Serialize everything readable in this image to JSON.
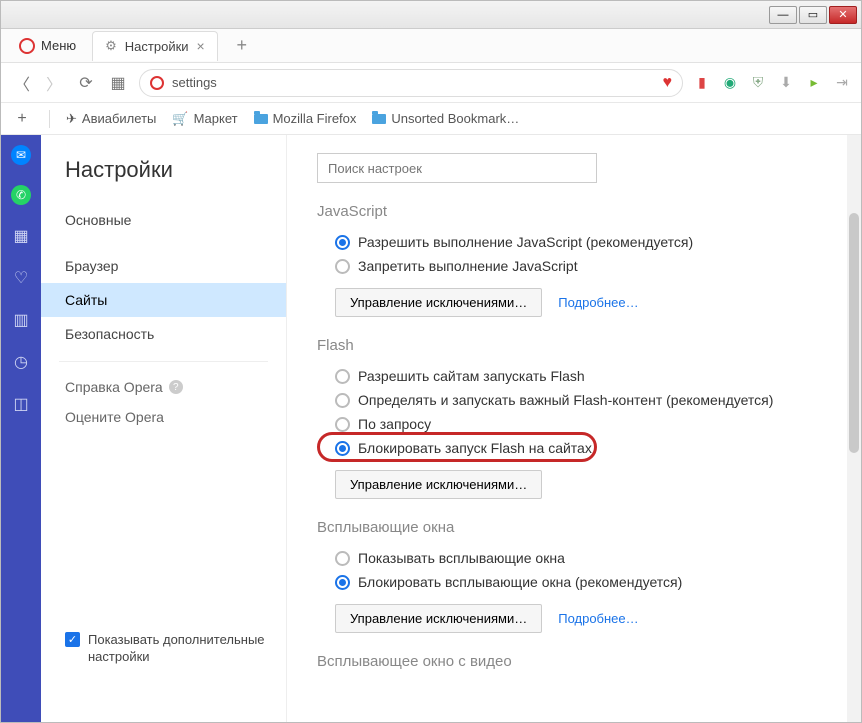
{
  "window": {
    "menu_label": "Меню"
  },
  "tab": {
    "title": "Настройки"
  },
  "address": {
    "url_text": "settings"
  },
  "bookmarks": {
    "aviatickets": "Авиабилеты",
    "market": "Маркет",
    "mozilla": "Mozilla Firefox",
    "unsorted": "Unsorted Bookmark…"
  },
  "settings_nav": {
    "page_title": "Настройки",
    "items": {
      "basic": "Основные",
      "browser": "Браузер",
      "sites": "Сайты",
      "security": "Безопасность"
    },
    "help_opera": "Справка Opera",
    "rate_opera": "Оцените Opera",
    "advanced_label": "Показывать дополнительные настройки"
  },
  "search": {
    "placeholder": "Поиск настроек"
  },
  "sections": {
    "javascript": {
      "heading": "JavaScript",
      "allow": "Разрешить выполнение JavaScript (рекомендуется)",
      "deny": "Запретить выполнение JavaScript",
      "manage": "Управление исключениями…",
      "more": "Подробнее…"
    },
    "flash": {
      "heading": "Flash",
      "allow": "Разрешить сайтам запускать Flash",
      "detect": "Определять и запускать важный Flash-контент (рекомендуется)",
      "ondemand": "По запросу",
      "block": "Блокировать запуск Flash на сайтах",
      "manage": "Управление исключениями…"
    },
    "popups": {
      "heading": "Всплывающие окна",
      "show": "Показывать всплывающие окна",
      "block": "Блокировать всплывающие окна (рекомендуется)",
      "manage": "Управление исключениями…",
      "more": "Подробнее…"
    },
    "video_popup": {
      "heading": "Всплывающее окно с видео"
    }
  }
}
